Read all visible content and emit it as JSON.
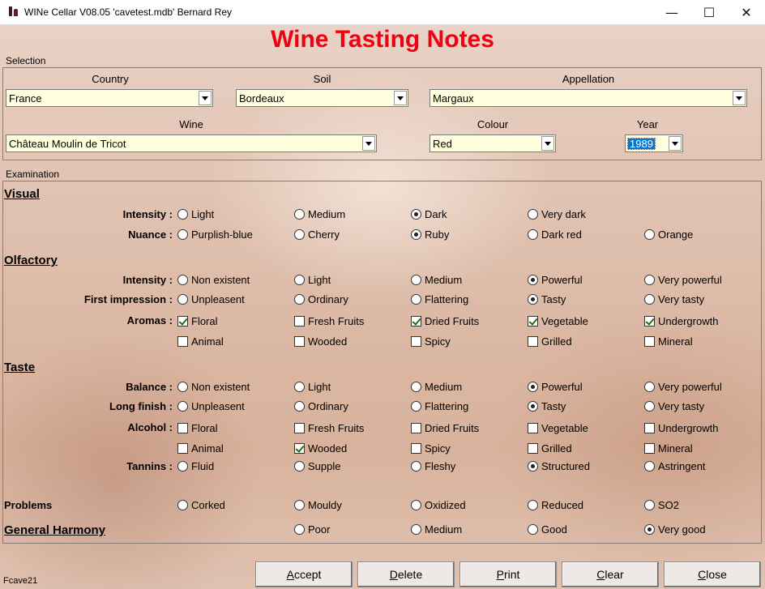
{
  "window": {
    "title": "WINe Cellar V08.05  'cavetest.mdb'   Bernard Rey",
    "minimize": "—",
    "maximize": "☐",
    "close": "✕"
  },
  "page_title": "Wine Tasting Notes",
  "selection": {
    "section": "Selection",
    "country": {
      "label": "Country",
      "value": "France"
    },
    "soil": {
      "label": "Soil",
      "value": "Bordeaux"
    },
    "appellation": {
      "label": "Appellation",
      "value": "Margaux"
    },
    "wine": {
      "label": "Wine",
      "value": "Château Moulin de Tricot"
    },
    "colour": {
      "label": "Colour",
      "value": "Red"
    },
    "year": {
      "label": "Year",
      "value": "1989"
    }
  },
  "examination": {
    "section": "Examination",
    "visual": {
      "title": "Visual",
      "intensity": {
        "label": "Intensity :",
        "options": [
          "Light",
          "Medium",
          "Dark",
          "Very dark"
        ],
        "selected": 2
      },
      "nuance": {
        "label": "Nuance :",
        "options": [
          "Purplish-blue",
          "Cherry",
          "Ruby",
          "Dark red",
          "Orange"
        ],
        "selected": 2
      }
    },
    "olfactory": {
      "title": "Olfactory",
      "intensity": {
        "label": "Intensity :",
        "options": [
          "Non existent",
          "Light",
          "Medium",
          "Powerful",
          "Very powerful"
        ],
        "selected": 3
      },
      "first_impression": {
        "label": "First impression :",
        "options": [
          "Unpleasent",
          "Ordinary",
          "Flattering",
          "Tasty",
          "Very tasty"
        ],
        "selected": 3
      },
      "aromas": {
        "label": "Aromas :",
        "row1": [
          "Floral",
          "Fresh Fruits",
          "Dried Fruits",
          "Vegetable",
          "Undergrowth"
        ],
        "row1_checked": [
          true,
          false,
          true,
          true,
          true
        ],
        "row2": [
          "Animal",
          "Wooded",
          "Spicy",
          "Grilled",
          "Mineral"
        ],
        "row2_checked": [
          false,
          false,
          false,
          false,
          false
        ]
      }
    },
    "taste": {
      "title": "Taste",
      "balance": {
        "label": "Balance :",
        "options": [
          "Non existent",
          "Light",
          "Medium",
          "Powerful",
          "Very powerful"
        ],
        "selected": 3
      },
      "long_finish": {
        "label": "Long finish :",
        "options": [
          "Unpleasent",
          "Ordinary",
          "Flattering",
          "Tasty",
          "Very tasty"
        ],
        "selected": 3
      },
      "alcohol": {
        "label": "Alcohol :",
        "row1": [
          "Floral",
          "Fresh Fruits",
          "Dried Fruits",
          "Vegetable",
          "Undergrowth"
        ],
        "row1_checked": [
          false,
          false,
          false,
          false,
          false
        ],
        "row2": [
          "Animal",
          "Wooded",
          "Spicy",
          "Grilled",
          "Mineral"
        ],
        "row2_checked": [
          false,
          true,
          false,
          false,
          false
        ]
      },
      "tannins": {
        "label": "Tannins :",
        "options": [
          "Fluid",
          "Supple",
          "Fleshy",
          "Structured",
          "Astringent"
        ],
        "selected": 3
      }
    },
    "problems": {
      "label": "Problems",
      "options": [
        "Corked",
        "Mouldy",
        "Oxidized",
        "Reduced",
        "SO2"
      ],
      "selected": -1
    },
    "general_harmony": {
      "label": "General Harmony",
      "options": [
        "Poor",
        "Medium",
        "Good",
        "Very good"
      ],
      "selected": 3
    }
  },
  "buttons": {
    "accept_u": "A",
    "accept_rest": "ccept",
    "delete_u": "D",
    "delete_rest": "elete",
    "print_u": "P",
    "print_rest": "rint",
    "clear_u": "C",
    "clear_rest": "lear",
    "close_u": "C",
    "close_rest": "lose"
  },
  "form_id": "Fcave21"
}
